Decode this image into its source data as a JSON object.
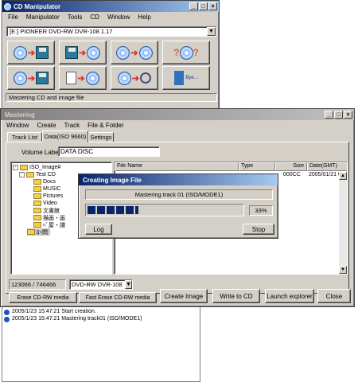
{
  "cd_manipulator": {
    "title": "CD Manipulator",
    "menu": [
      "File",
      "Manipulator",
      "Tools",
      "CD",
      "Window",
      "Help"
    ],
    "drive": "[E:] PIONEER  DVD-RW  DVR-108 1.17",
    "status": "Mastering CD and image file",
    "help_label": "Bye..."
  },
  "mastering": {
    "title": "Mastering",
    "menu": [
      "Window",
      "Create",
      "Track",
      "File & Folder"
    ],
    "tabs": [
      "Track List",
      "Data(ISO 9660)",
      "Settings"
    ],
    "volume_label_caption": "Volume Label",
    "volume_label_value": "DATA DISC",
    "tree": [
      {
        "label": "ISO_Image#"
      },
      {
        "label": "Test CD"
      },
      {
        "label": "Docs"
      },
      {
        "label": "MUSIC"
      },
      {
        "label": "Pictures"
      },
      {
        "label": "Video"
      },
      {
        "label": "文書館"
      },
      {
        "label": "描画・画"
      },
      {
        "label": "ﾍﾞ屋・譜"
      },
      {
        "label": "ﾛｰ閃"
      }
    ],
    "columns": [
      "File Name",
      "Type",
      "Size",
      "Date(GMT)"
    ],
    "file_row": {
      "size": "000CC",
      "date": "2005/01/21 0"
    },
    "size_readout": "123066 / 746466",
    "drive_select": "DVD-RW  DVR-108",
    "buttons": {
      "erase": "Erase CD-RW media",
      "fast_erase": "Fast Erase CD-RW media",
      "create_image": "Create Image",
      "write_to_cd": "Write to CD",
      "launch_explorer": "Launch explorer",
      "close": "Close"
    }
  },
  "dialog": {
    "title": "Creating Image File",
    "message": "Mastering track 01 (ISO/MODE1)",
    "percent": "33%",
    "progress": 0.33,
    "log_button": "Log",
    "stop_button": "Stop"
  },
  "log": {
    "lines": [
      "2005/1/23 15:47:21 Start creation.",
      "2005/1/23 15:47:21 Mastering track01 (ISO/MODE1)"
    ]
  }
}
